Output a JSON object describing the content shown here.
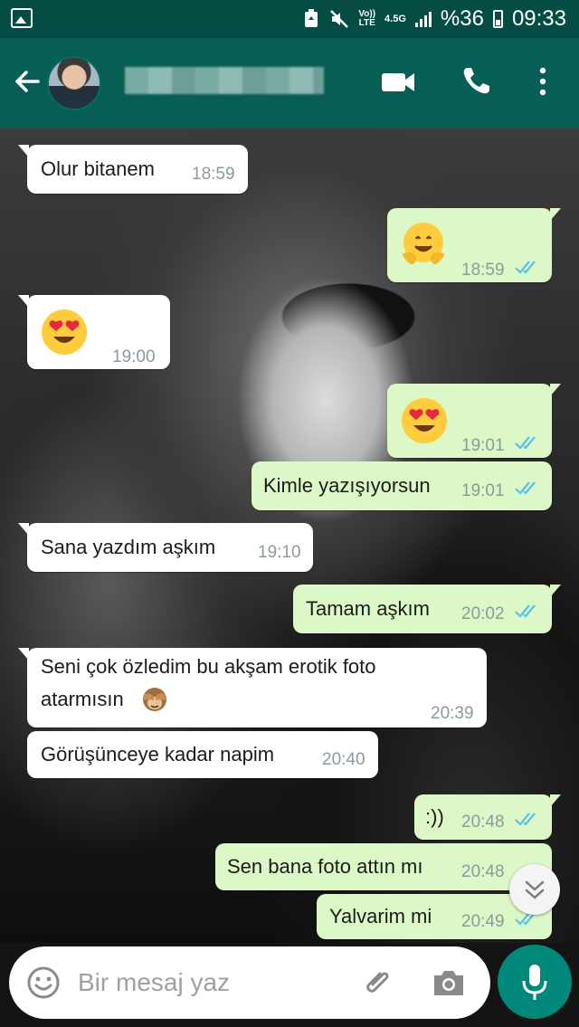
{
  "status_bar": {
    "volte": "Vo))",
    "lte": "LTE",
    "network": "4.5G",
    "battery": "%36",
    "time": "09:33"
  },
  "header": {
    "contact_name": "████████████"
  },
  "messages": [
    {
      "dir": "in",
      "text": "Olur bitanem",
      "time": "18:59"
    },
    {
      "dir": "out",
      "emoji": "hugging-face",
      "time": "18:59"
    },
    {
      "dir": "in",
      "emoji": "heart-eyes",
      "time": "19:00"
    },
    {
      "dir": "out",
      "emoji": "heart-eyes",
      "time": "19:01"
    },
    {
      "dir": "out",
      "text": "Kimle yazışıyorsun",
      "time": "19:01"
    },
    {
      "dir": "in",
      "text": "Sana yazdım aşkım",
      "time": "19:10"
    },
    {
      "dir": "out",
      "text": "Tamam aşkım",
      "time": "20:02"
    },
    {
      "dir": "in",
      "text_line1": "Seni çok özledim bu akşam erotik foto",
      "text_line2": "atarmısın",
      "emoji": "see-no-evil-monkey",
      "time": "20:39"
    },
    {
      "dir": "in",
      "text": "Görüşünceye kadar napim",
      "time": "20:40"
    },
    {
      "dir": "out",
      "text": ":))",
      "time": "20:48"
    },
    {
      "dir": "out",
      "text": "Sen bana foto attın mı",
      "time": "20:48"
    },
    {
      "dir": "out",
      "text": "Yalvarim mi",
      "time": "20:49"
    }
  ],
  "input": {
    "placeholder": "Bir mesaj yaz"
  },
  "colors": {
    "header": "#075e54",
    "status_bar": "#054c44",
    "incoming_bubble": "#ffffff",
    "outgoing_bubble": "#dcf8c6",
    "read_ticks": "#4fc3f7",
    "mic_button": "#00897b"
  }
}
